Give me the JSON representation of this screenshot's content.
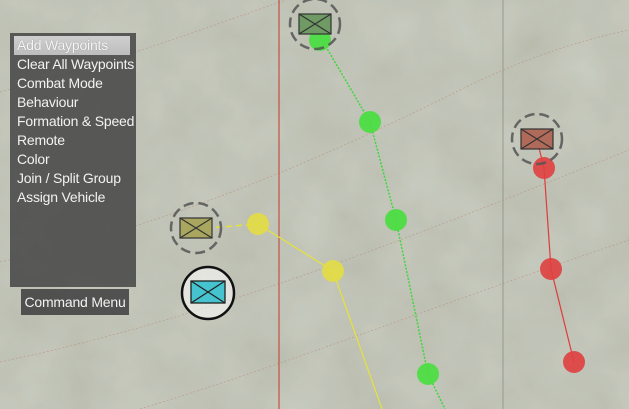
{
  "command_menu": {
    "title": "Command Menu",
    "selected_index": 0,
    "items": [
      {
        "label": "Add Waypoints"
      },
      {
        "label": "Clear All Waypoints"
      },
      {
        "label": "Combat Mode"
      },
      {
        "label": "Behaviour"
      },
      {
        "label": "Formation & Speed"
      },
      {
        "label": "Remote"
      },
      {
        "label": "Color"
      },
      {
        "label": "Join / Split Group"
      },
      {
        "label": "Assign Vehicle"
      }
    ]
  },
  "units": [
    {
      "name": "green-group",
      "color": "#3fd63f",
      "marker_fill": "#6f9a63"
    },
    {
      "name": "red-group",
      "color": "#e03a3a",
      "marker_fill": "#b06a5a"
    },
    {
      "name": "yellow-group",
      "color": "#d8d83a",
      "marker_fill": "#a8a65f"
    },
    {
      "name": "selected-group",
      "color": "#45c3cf",
      "marker_fill": "#45c3cf"
    }
  ],
  "colors": {
    "grid_line_red": "#c33b2b",
    "grid_line_gray": "#8e8e85",
    "menu_background": "#464646",
    "menu_text": "#f2f2f2"
  }
}
